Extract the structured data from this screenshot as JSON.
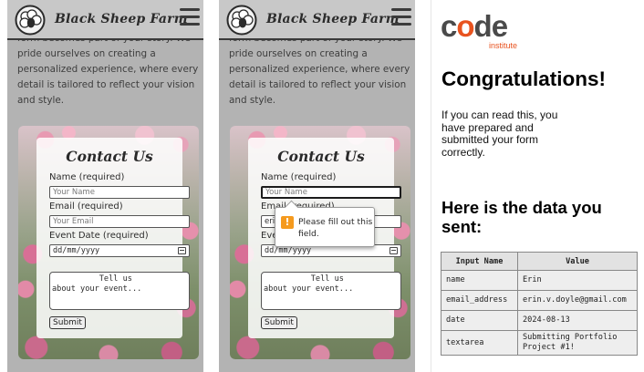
{
  "site": {
    "brand_name": "Black Sheep Farm",
    "intro_text": "form becomes part of your story. We pride ourselves on creating a personalized experience, where every detail is tailored to reflect your vision and style."
  },
  "contact_form": {
    "title": "Contact Us",
    "name_label": "Name (required)",
    "name_placeholder": "Your Name",
    "email_label": "Email (required)",
    "email_placeholder": "Your Email",
    "email_value_partial": "erin",
    "date_label": "Event Date (required)",
    "date_placeholder": "dd/mm/yyyy",
    "textarea_placeholder": "          Tell us\nabout your event...",
    "submit_label": "Submit"
  },
  "validation": {
    "message": "Please fill out this field."
  },
  "result_page": {
    "logo_text_code": "code",
    "logo_sub": "institute",
    "heading": "Congratulations!",
    "paragraph": "If you can read this, you have prepared and submitted your form correctly.",
    "subheading": "Here is the data you sent:",
    "table": {
      "headers": [
        "Input Name",
        "Value"
      ],
      "rows": [
        {
          "name": "name",
          "value": "Erin"
        },
        {
          "name": "email_address",
          "value": "erin.v.doyle@gmail.com"
        },
        {
          "name": "date",
          "value": "2024-08-13"
        },
        {
          "name": "textarea",
          "value": "Submitting Portfolio Project #1!"
        }
      ]
    }
  },
  "colors": {
    "brand_orange": "#e8531f",
    "warning_orange": "#f59a1e"
  },
  "icons": [
    "sheep-logo-icon",
    "hamburger-menu-icon",
    "calendar-icon",
    "warning-icon"
  ]
}
